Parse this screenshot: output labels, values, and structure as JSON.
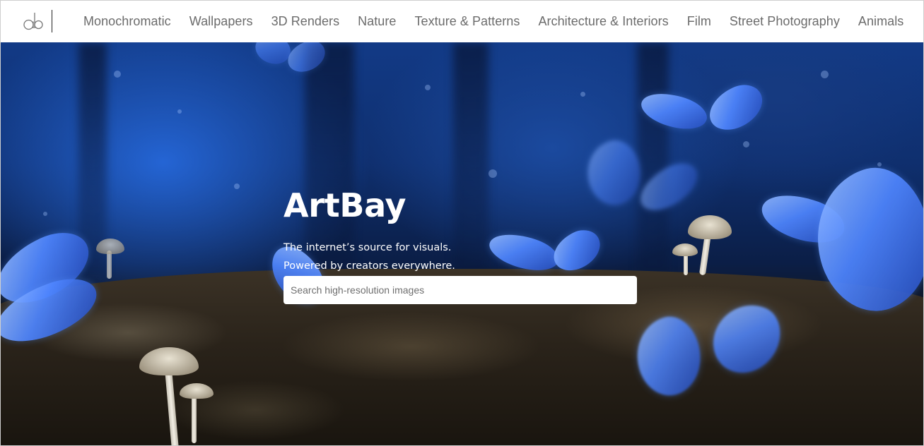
{
  "brand": {
    "logo_icon": "ab-monogram-icon",
    "name": "ArtBay"
  },
  "nav": {
    "items": [
      {
        "label": "Monochromatic"
      },
      {
        "label": "Wallpapers"
      },
      {
        "label": "3D Renders"
      },
      {
        "label": "Nature"
      },
      {
        "label": "Texture & Patterns"
      },
      {
        "label": "Architecture & Interiors"
      },
      {
        "label": "Film"
      },
      {
        "label": "Street Photography"
      },
      {
        "label": "Animals"
      }
    ]
  },
  "hero": {
    "title": "ArtBay",
    "tagline_line1": "The internet’s source for visuals.",
    "tagline_line2": "Powered by creators everywhere.",
    "search": {
      "placeholder": "Search high-resolution images",
      "value": ""
    },
    "background_description_icon": "butterflies-forest-photo"
  },
  "colors": {
    "nav_text": "#6b6b6b",
    "hero_text": "#ffffff",
    "accent_blue": "#4f86ff"
  }
}
